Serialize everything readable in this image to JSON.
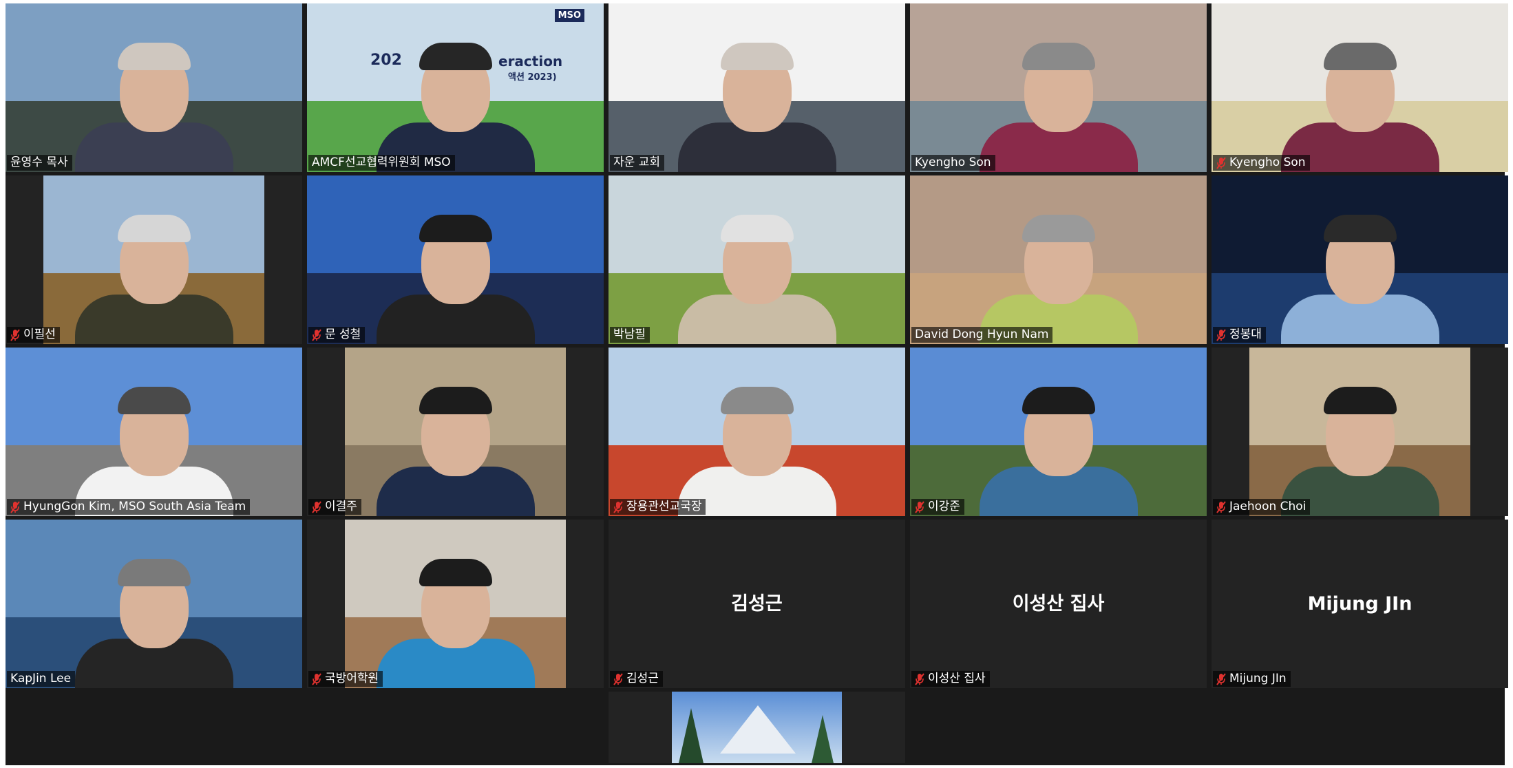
{
  "participants": [
    {
      "name": "윤영수 목사",
      "muted": false,
      "video": true,
      "active": true,
      "sky": "#7d9fc2",
      "ground": "#3d4a45",
      "shirt": "#3b3f52",
      "hair": "#cfc7bf"
    },
    {
      "name": "AMCF선교협력위원회 MSO",
      "muted": false,
      "video": true,
      "sky": "#c9dbe9",
      "ground": "#58a64b",
      "shirt": "#202a44",
      "hair": "#262626"
    },
    {
      "name": "자운 교회",
      "muted": false,
      "video": true,
      "sky": "#f2f2f2",
      "ground": "#56606a",
      "shirt": "#2d2f3a",
      "hair": "#cfc7bf"
    },
    {
      "name": "Kyengho Son",
      "muted": false,
      "video": true,
      "sky": "#b7a397",
      "ground": "#7a8a94",
      "shirt": "#8a2a4a",
      "hair": "#8a8a8a"
    },
    {
      "name": "Kyengho Son",
      "muted": true,
      "video": true,
      "sky": "#e8e6e1",
      "ground": "#d9cfa5",
      "shirt": "#7a2a44",
      "hair": "#6a6a6a"
    },
    {
      "name": "이필선",
      "muted": true,
      "video": true,
      "pillar": true,
      "sky": "#9bb6d2",
      "ground": "#8a6a3a",
      "shirt": "#3a3a2a",
      "hair": "#d6d6d6"
    },
    {
      "name": "문 성철",
      "muted": true,
      "video": true,
      "sky": "#2f63b8",
      "ground": "#1d2d55",
      "shirt": "#222222",
      "hair": "#1c1c1c"
    },
    {
      "name": "박남필",
      "muted": false,
      "video": true,
      "sky": "#c9d6dc",
      "ground": "#7da044",
      "shirt": "#c9bca5",
      "hair": "#e1e1e1"
    },
    {
      "name": "David Dong Hyun Nam",
      "muted": false,
      "video": true,
      "sky": "#b49a86",
      "ground": "#c7a37e",
      "shirt": "#b6c763",
      "hair": "#9a9a9a"
    },
    {
      "name": "정봉대",
      "muted": true,
      "video": true,
      "sky": "#0f1b33",
      "ground": "#1d3c6e",
      "shirt": "#8db0d8",
      "hair": "#2a2a2a"
    },
    {
      "name": "HyungGon Kim, MSO South Asia Team",
      "muted": true,
      "video": true,
      "sky": "#5d8fd6",
      "ground": "#7f7f7f",
      "shirt": "#f2f2f2",
      "hair": "#4a4a4a"
    },
    {
      "name": "이결주",
      "muted": true,
      "video": true,
      "pillar": true,
      "sky": "#b4a488",
      "ground": "#8a7a62",
      "shirt": "#1e2c4a",
      "hair": "#1c1c1c"
    },
    {
      "name": "장용관선교국장",
      "muted": true,
      "video": true,
      "sky": "#b7cfe7",
      "ground": "#c8472d",
      "shirt": "#f0f0ee",
      "hair": "#8a8a8a"
    },
    {
      "name": "이강준",
      "muted": true,
      "video": true,
      "sky": "#5a8cd4",
      "ground": "#4d6b3a",
      "shirt": "#3a6f9d",
      "hair": "#1c1c1c"
    },
    {
      "name": "Jaehoon Choi",
      "muted": true,
      "video": true,
      "pillar": true,
      "sky": "#c8b79a",
      "ground": "#8a6a48",
      "shirt": "#3a5240",
      "hair": "#1c1c1c"
    },
    {
      "name": "KapJin Lee",
      "muted": false,
      "video": true,
      "sky": "#5b88b8",
      "ground": "#2b4f7a",
      "shirt": "#252525",
      "hair": "#7a7a7a"
    },
    {
      "name": "국방어학원",
      "muted": true,
      "video": true,
      "pillar": true,
      "sky": "#cfc9bf",
      "ground": "#a07a58",
      "shirt": "#2a8ac6",
      "hair": "#1c1c1c"
    },
    {
      "name": "김성근",
      "muted": true,
      "video": false
    },
    {
      "name": "이성산 집사",
      "muted": true,
      "video": false
    },
    {
      "name": "Mijung JIn",
      "muted": true,
      "video": false
    }
  ],
  "shared_slide": {
    "line1": "202",
    "line2": "eraction",
    "line3": "액션 2023)",
    "logo": "MSO"
  },
  "colors": {
    "active_speaker": "#d8e23a",
    "muted_icon": "#e0322f",
    "tile_background": "#232323"
  },
  "icons": {
    "muted": "microphone-muted-icon"
  }
}
